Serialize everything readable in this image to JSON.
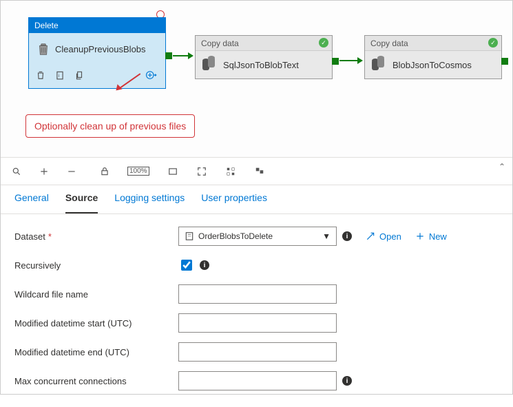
{
  "canvas": {
    "delete_activity": {
      "type_label": "Delete",
      "name": "CleanupPreviousBlobs"
    },
    "copy1": {
      "type_label": "Copy data",
      "name": "SqlJsonToBlobText"
    },
    "copy2": {
      "type_label": "Copy data",
      "name": "BlobJsonToCosmos"
    },
    "callout_text": "Optionally clean up of previous files"
  },
  "tabs": {
    "general": "General",
    "source": "Source",
    "logging": "Logging settings",
    "user_props": "User properties"
  },
  "form": {
    "dataset_label": "Dataset",
    "dataset_value": "OrderBlobsToDelete",
    "open_label": "Open",
    "new_label": "New",
    "recursively_label": "Recursively",
    "wildcard_label": "Wildcard file name",
    "mod_start_label": "Modified datetime start (UTC)",
    "mod_end_label": "Modified datetime end (UTC)",
    "max_conn_label": "Max concurrent connections"
  }
}
